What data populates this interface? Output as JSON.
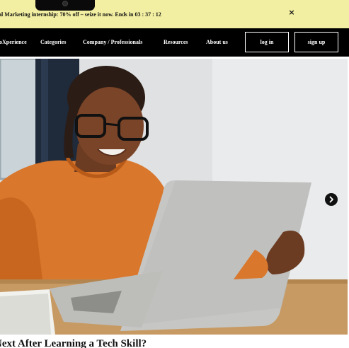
{
  "promo": {
    "text": "al Marketing internship: 70% off – seize it now.  Ends in 03 : 37 : 12",
    "close_icon": "×"
  },
  "nav": {
    "items": [
      "oXperience",
      "Categories",
      "Company / Professionals",
      "Resources",
      "About us"
    ],
    "login_label": "log in",
    "signup_label": "sign up"
  },
  "hero": {
    "next_icon": "chevron-right-icon"
  },
  "article": {
    "title": "Next After Learning a Tech Skill?"
  },
  "colors": {
    "promo_bg": "#f2efa2",
    "nav_bg": "#000000"
  }
}
